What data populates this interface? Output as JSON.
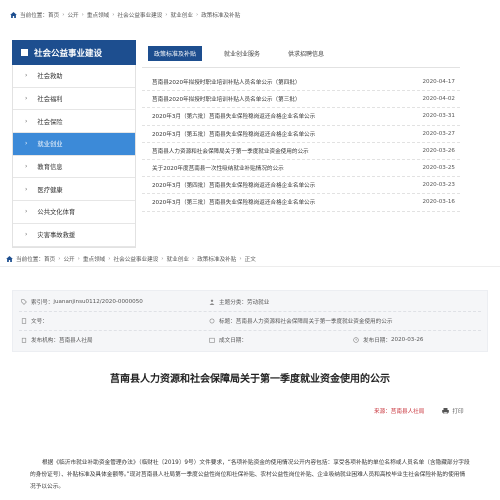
{
  "breadcrumb_top": {
    "prefix": "当前位置：",
    "items": [
      "首页",
      "公开",
      "重点领域",
      "社会公益事业建设",
      "就业创业",
      "政策标准及补贴"
    ]
  },
  "sidebar": {
    "title": "社会公益事业建设",
    "items": [
      {
        "label": "社会救助",
        "active": false
      },
      {
        "label": "社会福利",
        "active": false
      },
      {
        "label": "社会保险",
        "active": false
      },
      {
        "label": "就业创业",
        "active": true
      },
      {
        "label": "教育信息",
        "active": false
      },
      {
        "label": "医疗健康",
        "active": false
      },
      {
        "label": "公共文化体育",
        "active": false
      },
      {
        "label": "灾害事故救援",
        "active": false
      }
    ]
  },
  "tabs": [
    "政策标准及补贴",
    "就业创业服务",
    "供求招聘信息"
  ],
  "list": [
    {
      "title": "莒南县2020年拟授时职业培训补贴人员名单公示（第四批）",
      "date": "2020-04-17"
    },
    {
      "title": "莒南县2020年拟授时职业培训补贴人员名单公示（第三批）",
      "date": "2020-04-02"
    },
    {
      "title": "2020年3月（第六批）莒南县失业保险稳岗返还合格企业名单公示",
      "date": "2020-03-31"
    },
    {
      "title": "2020年3月（第五批）莒南县失业保险稳岗返还合格企业名单公示",
      "date": "2020-03-27"
    },
    {
      "title": "莒南县人力资源和社会保障局关于第一季度就业资金使用的公示",
      "date": "2020-03-26"
    },
    {
      "title": "关于2020年度莒南县一次性吸纳就业补贴情况的公示",
      "date": "2020-03-25"
    },
    {
      "title": "2020年3月（第四批）莒南县失业保险稳岗返还合格企业名单公示",
      "date": "2020-03-23"
    },
    {
      "title": "2020年3月（第三批）莒南县失业保险稳岗返还合格企业名单公示",
      "date": "2020-03-16"
    }
  ],
  "breadcrumb_bottom": {
    "prefix": "当前位置：",
    "items": [
      "首页",
      "公开",
      "重点领域",
      "社会公益事业建设",
      "就业创业",
      "政策标准及补贴",
      "正文"
    ]
  },
  "meta": {
    "index_label": "索引号：",
    "index_value": "juananjinsu0112/2020-0000050",
    "category_label": "主题分类：",
    "category_value": "劳动就业",
    "doc_label": "文号：",
    "doc_value": "",
    "topic_label": "标题：",
    "topic_value": "莒南县人力资源和社会保障局关于第一季度就业资金使用的公示",
    "org_label": "发布机构：",
    "org_value": "莒南县人社局",
    "created_label": "成文日期：",
    "created_value": "",
    "pub_label": "发布日期：",
    "pub_value": "2020-03-26"
  },
  "article": {
    "title": "莒南县人力资源和社会保障局关于第一季度就业资金使用的公示",
    "source": "来源：莒南县人社局",
    "print": "打印",
    "body": "根据《临沂市就业补助资金管理办法》（临财社〔2019〕9号）文件要求，“各项补贴资金的使用情况公开内容包括：享受各项补贴的单位名称或人员名单（含隐藏部分字段的身份证号）、补贴标准及具体金额等。”现对莒南县人社局第一季度公益性岗位和社保补贴、农村公益性岗位补贴、企业吸纳就业困难人员和高校毕业生社会保险补贴的使用情况予以公示。"
  },
  "colors": {
    "primary": "#1d4e8f",
    "active": "#3c8ad8",
    "source_red": "#c8323a"
  }
}
